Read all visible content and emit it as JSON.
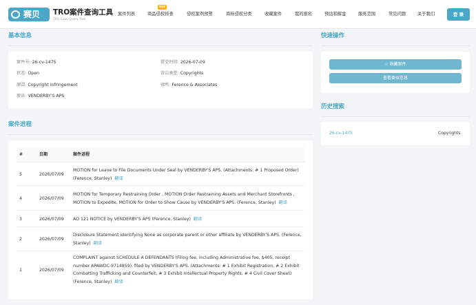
{
  "header": {
    "logo_text": "赛贝",
    "brand_title": "TRO案件查询工具",
    "brand_subtitle": "TRO Case Query Tool",
    "hot_badge": "Hot",
    "nav": [
      "案件列表",
      "商品侵权排查",
      "侵权案例预警",
      "商标侵权分类",
      "收藏案件",
      "我的报名",
      "预估和解金",
      "服务范围",
      "常见问题",
      "关于我们"
    ],
    "login_label": "登 录"
  },
  "basic_info": {
    "title": "基本信息",
    "case_no_label": "案件号:",
    "case_no": "26-cv-1475",
    "filed_label": "提交时间:",
    "filed": "2026-07-09",
    "status_label": "状态:",
    "status": "Open",
    "type_label": "诉讼类型:",
    "type": "Copyrights",
    "cause_label": "原因:",
    "cause": "Copyright Infringement",
    "firm_label": "律所:",
    "firm": "Ference & Associates",
    "plaintiff_label": "原告:",
    "plaintiff": "VENDERBY'S APS"
  },
  "progress": {
    "title": "案件进程",
    "col_num": "#",
    "col_date": "日期",
    "col_event": "案件进程",
    "translate_label": "翻译",
    "rows": [
      {
        "num": "5",
        "date": "2026/07/09",
        "text": "MOTION for Leave to File Documents Under Seal by VENDERBY'S APS. (Attachments: # 1 Proposed Order) (Ference, Stanley)"
      },
      {
        "num": "4",
        "date": "2026/07/09",
        "text": "MOTION for Temporary Restraining Order , MOTION Order Restraining Assets and Merchant Storefronts , MOTION to Expedite, MOTION for Order to Show Cause by VENDERBY'S APS. (Ference, Stanley)"
      },
      {
        "num": "3",
        "date": "2026/07/09",
        "text": "AO 121 NOTICE by VENDERBY'S APS (Ference, Stanley)"
      },
      {
        "num": "2",
        "date": "2026/07/09",
        "text": "Disclosure Statement identifying None as corporate parent or other affiliate by VENDERBY'S APS. (Ference, Stanley)"
      },
      {
        "num": "1",
        "date": "2026/07/09",
        "text": "COMPLAINT against SCHEDULE A DEFENDANTS (Filing fee, including Administrative fee, $405, receipt number APAWDC-9714859), filed by VENDERBY'S APS. (Attachments: # 1 Exhibit Registration, # 2 Exhibit Combatting Trafficking and Counterfeit, # 3 Exhibit Intellectual Property Rights, # 4 Civil Cover Sheet) (Ference, Stanley)"
      }
    ]
  },
  "quick_actions": {
    "title": "快速操作",
    "favorite_label": "收藏案件",
    "view_similar_label": "查看类似信息"
  },
  "history": {
    "title": "历史搜索",
    "case_no": "26-cv-1475",
    "type": "Copyrights"
  }
}
